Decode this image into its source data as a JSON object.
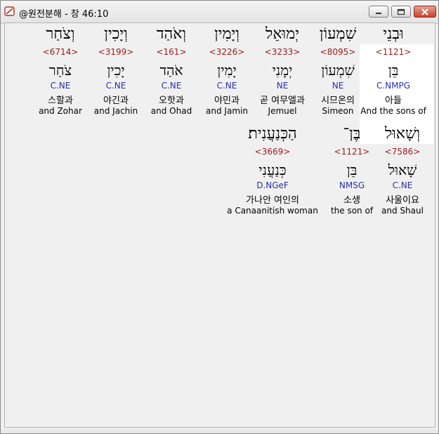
{
  "window": {
    "title": "@원전분해 - 창 46:10",
    "buttons": {
      "minimize": "minimize",
      "maximize": "maximize",
      "close": "close"
    }
  },
  "row1": [
    {
      "hebrew": "וּבְנֵי",
      "strong": "<1121>",
      "root": "בֵּן",
      "morph": "C.NMPG",
      "korean": "아들",
      "english": "And the sons of"
    },
    {
      "hebrew": "שִׁמְעוֹן",
      "strong": "<8095>",
      "root": "שִׁמְעוֹן",
      "morph": "NE",
      "korean": "시므온의",
      "english": "Simeon"
    },
    {
      "hebrew": "יְמוּאֵל",
      "strong": "<3233>",
      "root": "יְמָנִי",
      "morph": "NE",
      "korean": "곧 여무엘과",
      "english": "Jemuel"
    },
    {
      "hebrew": "וְיָמִין",
      "strong": "<3226>",
      "root": "יָמִין",
      "morph": "C.NE",
      "korean": "야민과",
      "english": "and Jamin"
    },
    {
      "hebrew": "וְאֹהַד",
      "strong": "<161>",
      "root": "אֹהַד",
      "morph": "C.NE",
      "korean": "오핫과",
      "english": "and Ohad"
    },
    {
      "hebrew": "וְיָכִין",
      "strong": "<3199>",
      "root": "יָכִין",
      "morph": "C.NE",
      "korean": "야긴과",
      "english": "and Jachin"
    },
    {
      "hebrew": "וְצֹחַר",
      "strong": "<6714>",
      "root": "צֹחַר",
      "morph": "C.NE",
      "korean": "스할과",
      "english": "and Zohar"
    }
  ],
  "row2": [
    {
      "hebrew": "וְשָׁאוּל",
      "strong": "<7586>",
      "root": "שָׁאוּל",
      "morph": "C.NE",
      "korean": "사울이요",
      "english": "and Shaul"
    },
    {
      "hebrew": "בֶּן־",
      "strong": "<1121>",
      "root": "בֵּן",
      "morph": "NMSG",
      "korean": "소생",
      "english": "the son of"
    },
    {
      "hebrew": "הַכְּנַעֲנִית׃",
      "strong": "<3669>",
      "root": "כְּנַעֲנִי",
      "morph": "D.NGeF",
      "korean": "가나안 여인의",
      "english": "a Canaanitish woman"
    }
  ],
  "colors": {
    "strong": "#9b1b1b",
    "morph": "#2a2fb0",
    "highlight": "#ffffff"
  },
  "icons": {
    "app": "scroll-icon"
  }
}
